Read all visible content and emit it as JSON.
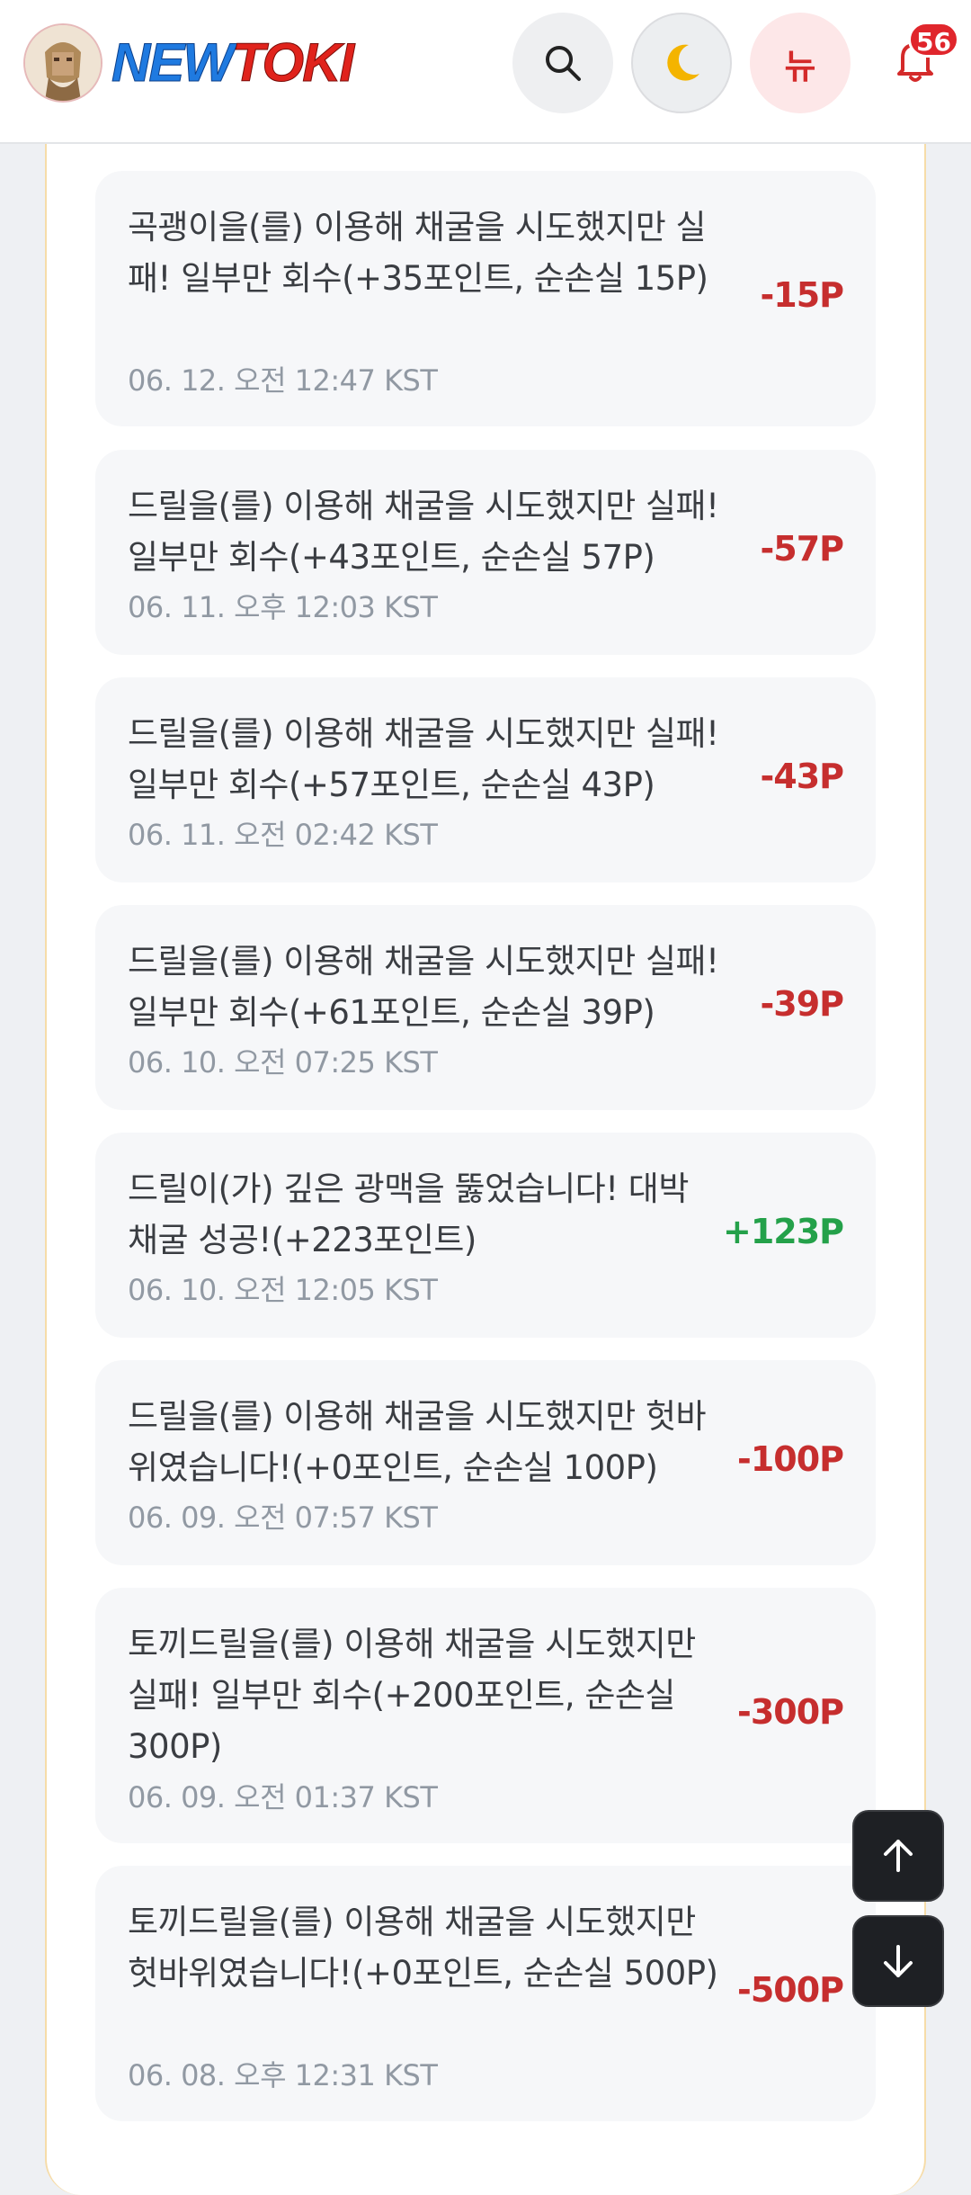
{
  "header": {
    "logo_new": "NEW",
    "logo_toki": "TOKI",
    "news_label": "뉴",
    "notification_count": "56"
  },
  "entries": [
    {
      "text": "곡괭이을(를) 이용해 채굴을 시도했지만 실패! 일부만 회수(+35포인트, 순손실 15P)",
      "time": "06. 12. 오전 12:47 KST",
      "amount": "-15P"
    },
    {
      "text": "드릴을(를) 이용해 채굴을 시도했지만 실패! 일부만 회수(+43포인트, 순손실 57P)",
      "time": "06. 11. 오후 12:03 KST",
      "amount": "-57P"
    },
    {
      "text": "드릴을(를) 이용해 채굴을 시도했지만 실패! 일부만 회수(+57포인트, 순손실 43P)",
      "time": "06. 11. 오전 02:42 KST",
      "amount": "-43P"
    },
    {
      "text": "드릴을(를) 이용해 채굴을 시도했지만 실패! 일부만 회수(+61포인트, 순손실 39P)",
      "time": "06. 10. 오전 07:25 KST",
      "amount": "-39P"
    },
    {
      "text": "드릴이(가) 깊은 광맥을 뚫었습니다! 대박 채굴 성공!(+223포인트)",
      "time": "06. 10. 오전 12:05 KST",
      "amount": "+123P"
    },
    {
      "text": "드릴을(를) 이용해 채굴을 시도했지만 헛바위였습니다!(+0포인트, 순손실 100P)",
      "time": "06. 09. 오전 07:57 KST",
      "amount": "-100P"
    },
    {
      "text": "토끼드릴을(를) 이용해 채굴을 시도했지만 실패! 일부만 회수(+200포인트, 순손실 300P)",
      "time": "06. 09. 오전 01:37 KST",
      "amount": "-300P"
    },
    {
      "text": "토끼드릴을(를) 이용해 채굴을 시도했지만 헛바위였습니다!(+0포인트, 순손실 500P)",
      "time": "06. 08. 오후 12:31 KST",
      "amount": "-500P"
    }
  ],
  "colors": {
    "negative": "#c62e2e",
    "positive": "#24a14a",
    "badge": "#e0262c"
  }
}
